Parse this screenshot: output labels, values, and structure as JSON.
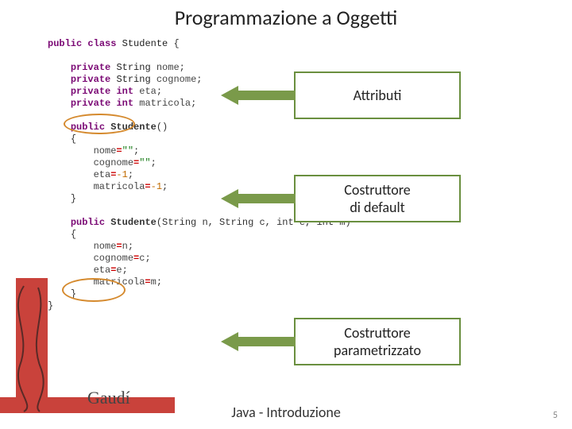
{
  "title": "Programmazione a Oggetti",
  "footer": "Java - Introduzione",
  "page": "5",
  "signature": "Gaudí",
  "callouts": {
    "attributes": "Attributi",
    "default_ctor_l1": "Costruttore",
    "default_ctor_l2": "di default",
    "param_ctor_l1": "Costruttore",
    "param_ctor_l2": "parametrizzato"
  },
  "code": {
    "class_decl": {
      "kw1": "public",
      "kw2": "class",
      "name": "Studente",
      "brace": "{"
    },
    "attrs": [
      {
        "kw": "private",
        "type": "String",
        "name": "nome"
      },
      {
        "kw": "private",
        "type": "String",
        "name": "cognome"
      },
      {
        "kw": "private",
        "type": "int",
        "name": "eta"
      },
      {
        "kw": "private",
        "type": "int",
        "name": "matricola"
      }
    ],
    "ctor_default": {
      "kw": "public",
      "name": "Studente",
      "params": "()",
      "body": [
        {
          "lhs": "nome",
          "rhs": "\"\""
        },
        {
          "lhs": "cognome",
          "rhs": "\"\""
        },
        {
          "lhs": "eta",
          "rhs": "-1"
        },
        {
          "lhs": "matricola",
          "rhs": "-1"
        }
      ]
    },
    "ctor_param": {
      "kw": "public",
      "name": "Studente",
      "params_text": "(String n, String c, int e, int m)",
      "body": [
        {
          "lhs": "nome",
          "rhs": "n"
        },
        {
          "lhs": "cognome",
          "rhs": "c"
        },
        {
          "lhs": "eta",
          "rhs": "e"
        },
        {
          "lhs": "matricola",
          "rhs": "m"
        }
      ]
    }
  }
}
